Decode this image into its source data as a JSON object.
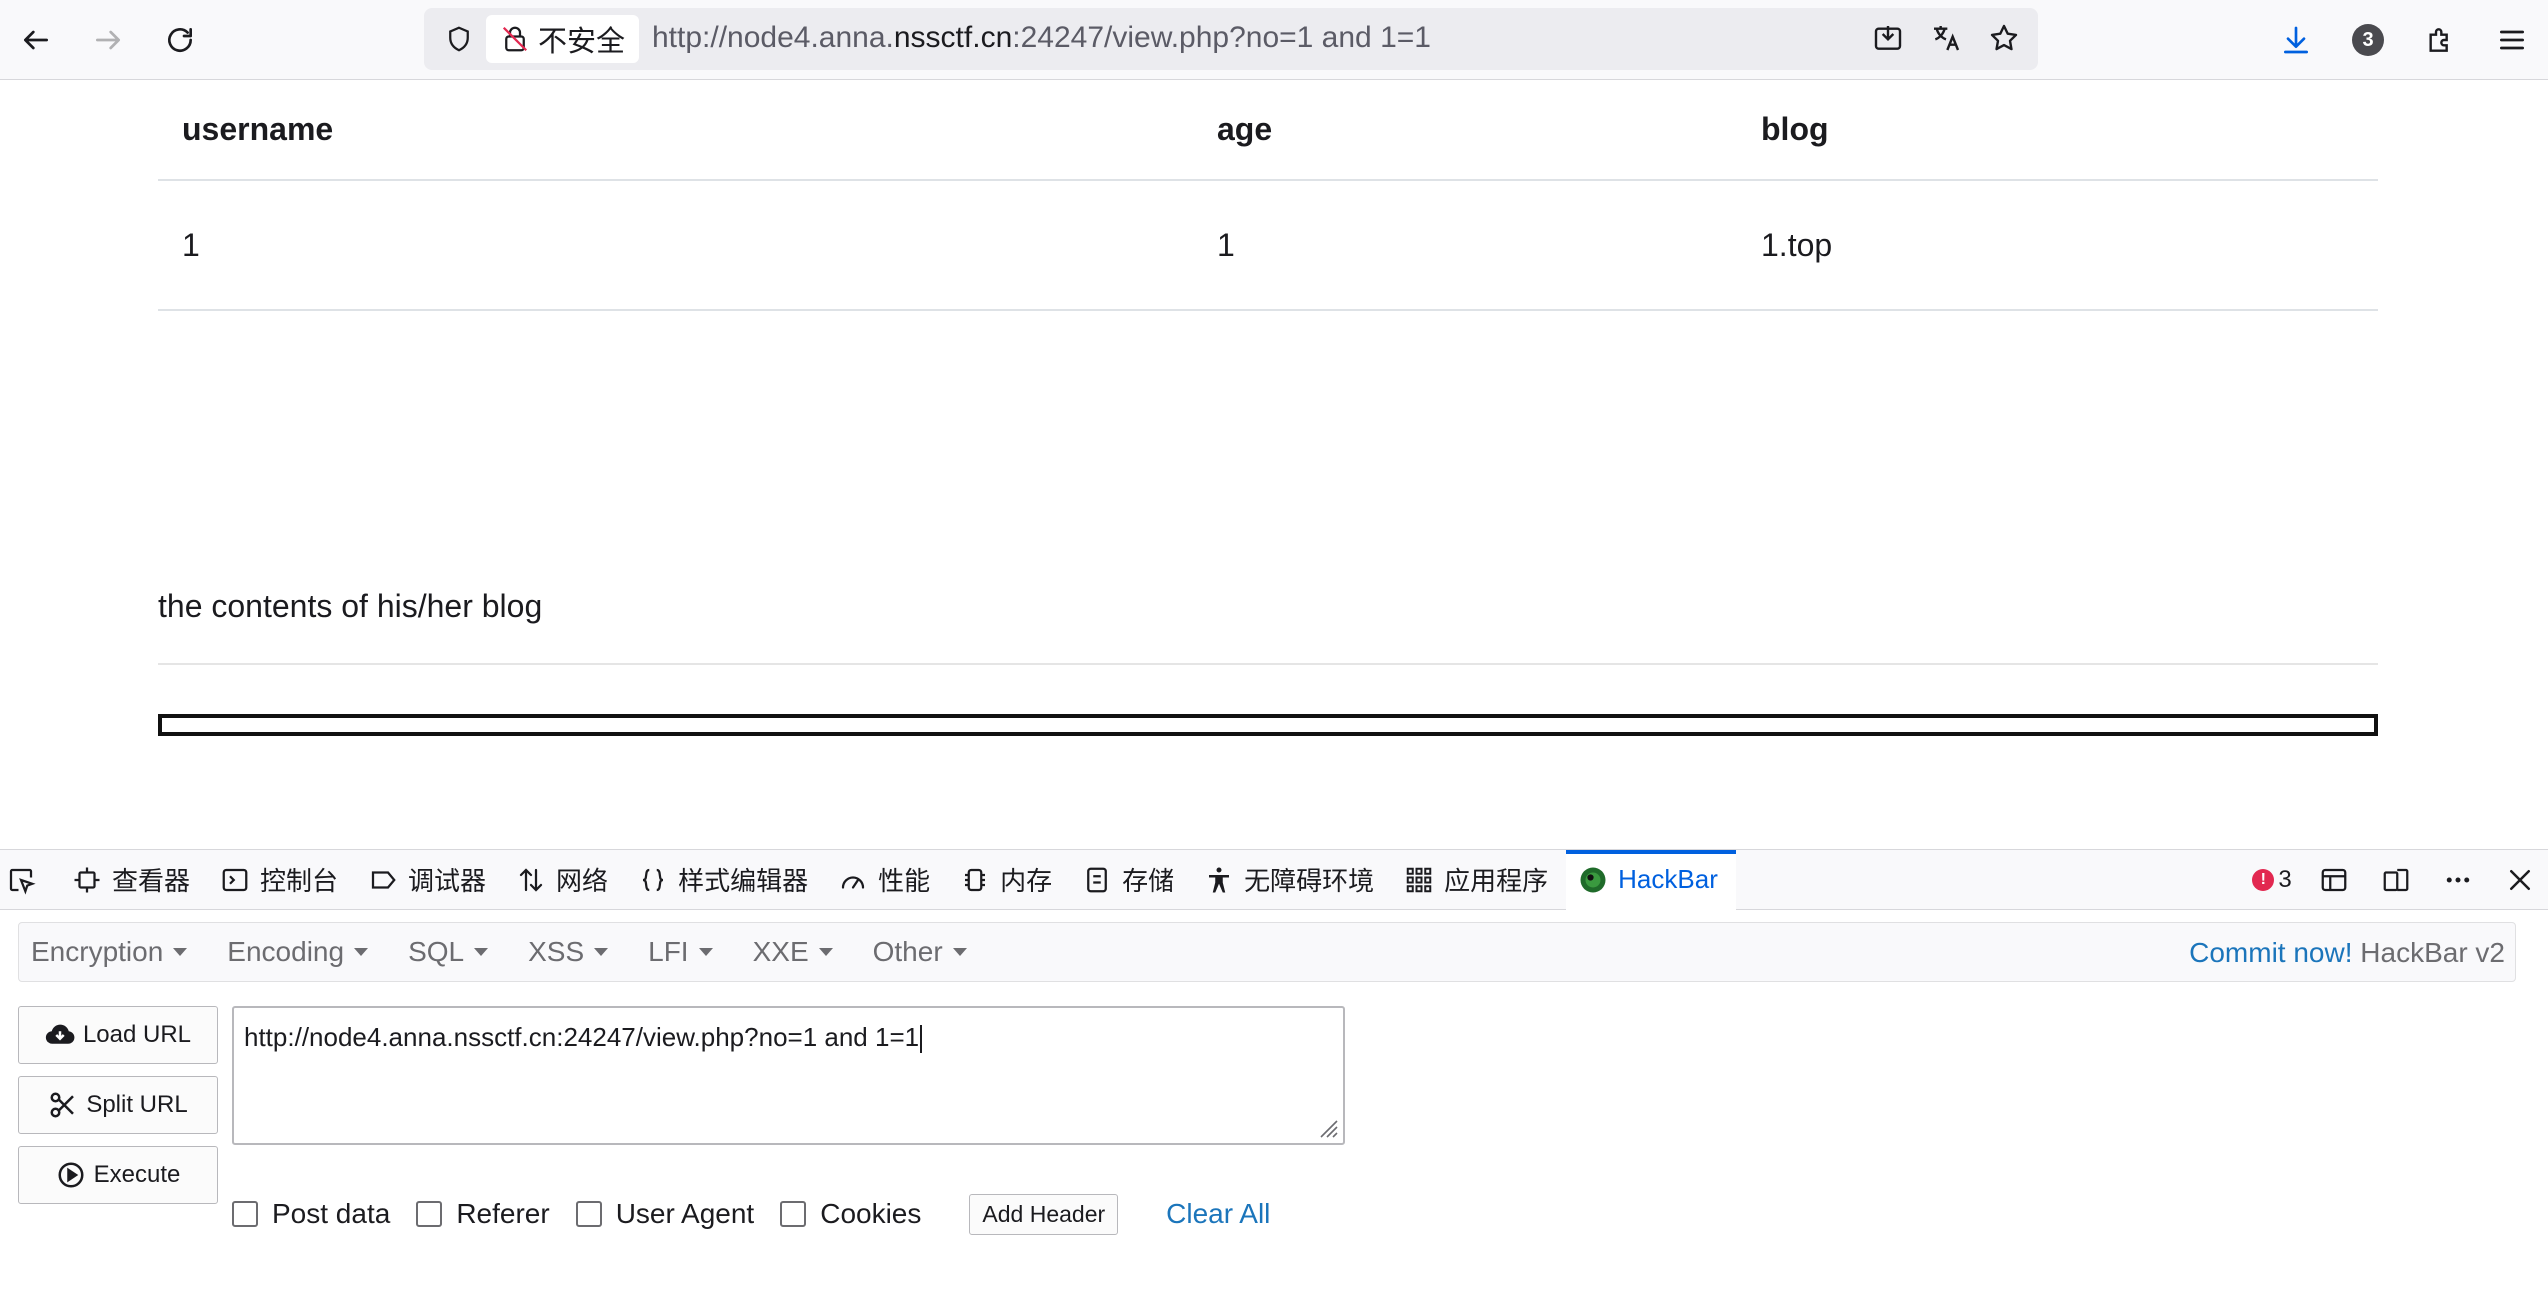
{
  "browser": {
    "security_label": "不安全",
    "url_prefix": "http://node4.anna.",
    "url_domain": "nssctf.cn",
    "url_suffix": ":24247/view.php?no=1 and 1=1",
    "download_count": "3"
  },
  "table": {
    "headers": [
      "username",
      "age",
      "blog"
    ],
    "rows": [
      [
        "1",
        "1",
        "1.top"
      ]
    ]
  },
  "blog_contents": "the contents of his/her blog",
  "devtools": {
    "tabs": [
      "查看器",
      "控制台",
      "调试器",
      "网络",
      "样式编辑器",
      "性能",
      "内存",
      "存储",
      "无障碍环境",
      "应用程序",
      "HackBar"
    ],
    "active_tab": "HackBar",
    "error_count": "3"
  },
  "hackbar": {
    "menus": [
      "Encryption",
      "Encoding",
      "SQL",
      "XSS",
      "LFI",
      "XXE",
      "Other"
    ],
    "commit_link": "Commit now!",
    "brand": "HackBar v2",
    "load_url": "Load URL",
    "split_url": "Split URL",
    "execute": "Execute",
    "url_value": "http://node4.anna.nssctf.cn:24247/view.php?no=1 and 1=1",
    "options": [
      "Post data",
      "Referer",
      "User Agent",
      "Cookies"
    ],
    "add_header": "Add Header",
    "clear_all": "Clear All"
  },
  "colors": {
    "accent": "#0060df",
    "link": "#1b75bb",
    "error": "#e22850"
  }
}
